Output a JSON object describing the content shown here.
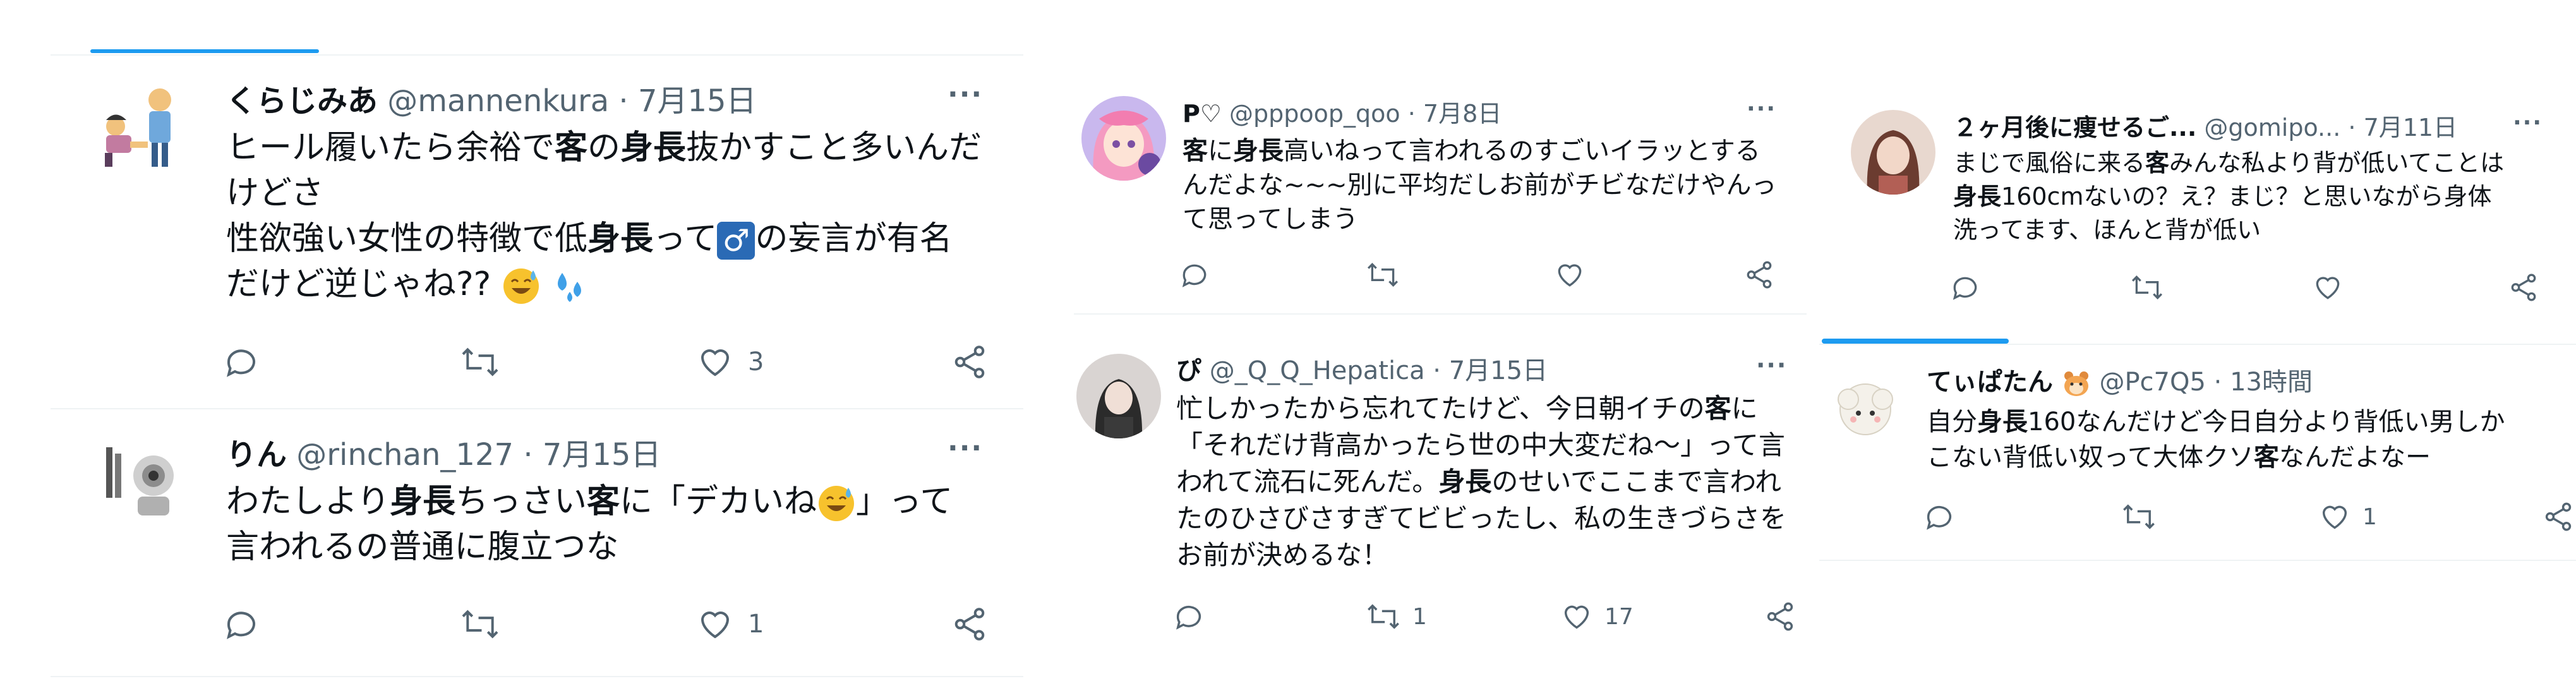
{
  "left": {
    "tweets": [
      {
        "name": "くらじみあ",
        "handle": "@mannenkura",
        "sep": "·",
        "date": "7月15日",
        "more": "···",
        "lines": [
          [
            "ヒール履いたら余裕で",
            "客",
            "の",
            "身長",
            "抜かすこと多いんだ"
          ],
          [
            "けどさ"
          ],
          [
            "性欲強い女性の特徴で低",
            "身長",
            "って",
            "♂",
            "の妄言が有名"
          ],
          [
            "だけど逆じゃね??"
          ]
        ],
        "line1": {
          "a": "ヒール履いたら余裕で",
          "b": "客",
          "c": "の",
          "d": "身長",
          "e": "抜かすこと多いんだ"
        },
        "line2": "けどさ",
        "line3": {
          "a": "性欲強い女性の特徴で低",
          "b": "身長",
          "c": "って",
          "male": "♂",
          "d": "の妄言が有名"
        },
        "line4": "だけど逆じゃね??",
        "like_count": "3"
      },
      {
        "name": "りん",
        "handle": "@rinchan_127",
        "sep": "·",
        "date": "7月15日",
        "more": "···",
        "line1": {
          "a": "わたしより",
          "b": "身長",
          "c": "ちっさい",
          "d": "客",
          "e": "に「デカいね",
          "f": "」って"
        },
        "line2": "言われるの普通に腹立つな",
        "like_count": "1"
      }
    ]
  },
  "middle": {
    "tweets": [
      {
        "name": "P♡",
        "handle": "@pppoop_qoo",
        "sep": "·",
        "date": "7月8日",
        "more": "···",
        "line1": {
          "a": "客",
          "b": "に",
          "c": "身長",
          "d": "高いねって言われるのすごいイラッとする"
        },
        "line2": "んだよな~~~別に平均だしお前がチビなだけやんっ",
        "line3": "て思ってしまう"
      },
      {
        "name": "ぴ",
        "handle": "@_Q_Q_Hepatica",
        "sep": "·",
        "date": "7月15日",
        "more": "···",
        "line1": {
          "a": "忙しかったから忘れてたけど、今日朝イチの",
          "b": "客",
          "c": "に"
        },
        "line2": "「それだけ背高かったら世の中大変だね〜」って言",
        "line3": {
          "a": "われて流石に死んだ。",
          "b": "身長",
          "c": "のせいでここまで言われ"
        },
        "line4": "たのひさびさすぎてビビったし、私の生きづらさを",
        "line5": "お前が決めるな！",
        "retweet_count": "1",
        "like_count": "17"
      }
    ]
  },
  "right": {
    "tweets": [
      {
        "name": "２ヶ月後に痩せるご...",
        "handle": "@gomipo...",
        "sep": "·",
        "date": "7月11日",
        "more": "···",
        "line1": {
          "a": "まじで風俗に来る",
          "b": "客",
          "c": "みんな私より背が低いてことは"
        },
        "line2": {
          "a": "身長",
          "b": "160cmないの？え？まじ？と思いながら身体"
        },
        "line3": "洗ってます、ほんと背が低い"
      },
      {
        "name": "てぃぱたん",
        "handle": "@Pc7Q5",
        "sep": "·",
        "date": "13時間",
        "more": "",
        "line1": {
          "a": "自分",
          "b": "身長",
          "c": "160なんだけど今日自分より背低い男しか"
        },
        "line2": {
          "a": "こない背低い奴って大体クソ",
          "b": "客",
          "c": "なんだよなー"
        },
        "like_count": "1"
      }
    ]
  },
  "colors": {
    "accent": "#1d9bf0",
    "text": "#0f1419",
    "muted": "#536471",
    "divider": "#eff3f4"
  }
}
